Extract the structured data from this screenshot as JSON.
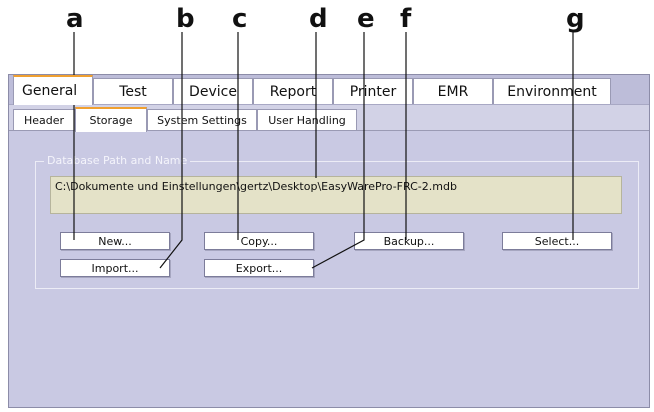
{
  "callouts": [
    "a",
    "b",
    "c",
    "d",
    "e",
    "f",
    "g"
  ],
  "main_tabs": [
    "General",
    "Test",
    "Device",
    "Report",
    "Printer",
    "EMR",
    "Environment"
  ],
  "sub_tabs": [
    "Header",
    "Storage",
    "System Settings",
    "User Handling"
  ],
  "database_group": {
    "legend": "Database Path and Name",
    "path_value": "C:\\Dokumente und Einstellungen\\gertz\\Desktop\\EasyWarePro-FRC-2.mdb"
  },
  "buttons": {
    "new": "New...",
    "copy": "Copy...",
    "backup": "Backup...",
    "select": "Select...",
    "import": "Import...",
    "export": "Export..."
  },
  "colors": {
    "panel_background": "#c9c9e3",
    "active_tab_accent": "#f0a030",
    "path_field_background": "#e4e2c8"
  }
}
